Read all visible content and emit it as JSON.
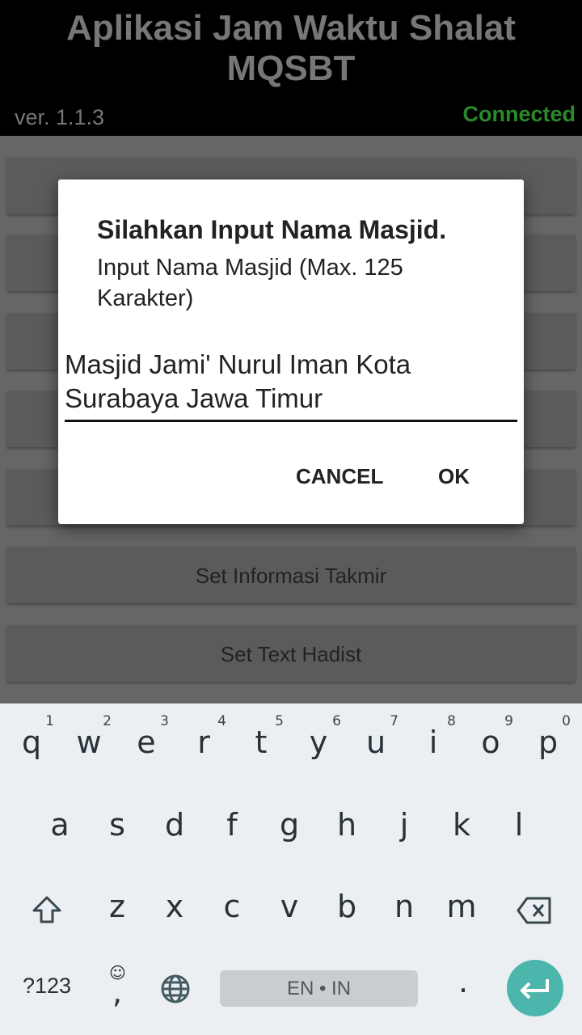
{
  "app": {
    "title": "Aplikasi Jam Waktu Shalat MQSBT",
    "version": "ver. 1.1.3",
    "status": "Connected",
    "status_color": "#2a8a2a"
  },
  "menu": [
    {
      "label": ""
    },
    {
      "label": ""
    },
    {
      "label": ""
    },
    {
      "label": ""
    },
    {
      "label": ""
    },
    {
      "label": "Set Informasi Takmir"
    },
    {
      "label": "Set Text Hadist"
    }
  ],
  "dialog": {
    "title": "Silahkan Input Nama Masjid.",
    "message": "Input Nama Masjid (Max. 125 Karakter)",
    "input_value": "Masjid Jami' Nurul Iman Kota Surabaya Jawa Timur",
    "cancel": "CANCEL",
    "ok": "OK"
  },
  "keyboard": {
    "row1": [
      "q",
      "w",
      "e",
      "r",
      "t",
      "y",
      "u",
      "i",
      "o",
      "p"
    ],
    "row1_hints": [
      "1",
      "2",
      "3",
      "4",
      "5",
      "6",
      "7",
      "8",
      "9",
      "0"
    ],
    "row2": [
      "a",
      "s",
      "d",
      "f",
      "g",
      "h",
      "j",
      "k",
      "l"
    ],
    "row3": [
      "z",
      "x",
      "c",
      "v",
      "b",
      "n",
      "m"
    ],
    "symbols": "?123",
    "comma": ",",
    "space": "EN • IN",
    "period": ".",
    "accent": "#4db6ac"
  }
}
